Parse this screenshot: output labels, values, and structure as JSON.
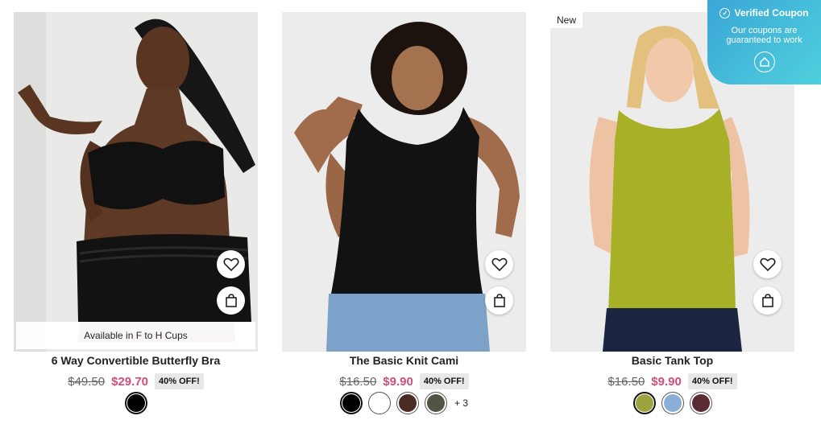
{
  "products": [
    {
      "name": "6 Way Convertible Butterfly Bra",
      "old_price": "$49.50",
      "price": "$29.70",
      "discount": "40% OFF!",
      "note": "Available in F to H Cups",
      "badge": "",
      "swatches": [
        "#000000"
      ],
      "more_colors": ""
    },
    {
      "name": "The Basic Knit Cami",
      "old_price": "$16.50",
      "price": "$9.90",
      "discount": "40% OFF!",
      "note": "",
      "badge": "",
      "swatches": [
        "#000000",
        "#ffffff",
        "#4a2a25",
        "#505545"
      ],
      "more_colors": "+ 3"
    },
    {
      "name": "Basic Tank Top",
      "old_price": "$16.50",
      "price": "$9.90",
      "discount": "40% OFF!",
      "note": "",
      "badge": "New",
      "swatches": [
        "#9aa53f",
        "#8aaed8",
        "#5a2a35"
      ],
      "more_colors": ""
    }
  ],
  "coupon": {
    "title": "Verified Coupon",
    "text": "Our coupons are guaranteed to work"
  },
  "icons": {
    "wishlist": "heart-icon",
    "add_to_bag": "shopping-bag-icon",
    "verified": "check-circle-icon",
    "coupon_logo": "house-logo-icon"
  },
  "colors": {
    "sale_price": "#d24d7c",
    "coupon_gradient_start": "#3aa6d6",
    "coupon_gradient_end": "#4fd0dd"
  }
}
